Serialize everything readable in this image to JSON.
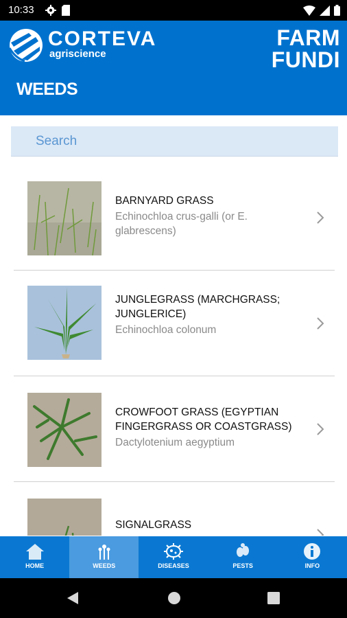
{
  "status": {
    "time": "10:33"
  },
  "header": {
    "brand_name": "CORTEVA",
    "brand_sub": "agriscience",
    "app_name_line1": "FARM",
    "app_name_line2": "FUNDI",
    "page_title": "WEEDS"
  },
  "search": {
    "placeholder": "Search"
  },
  "items": [
    {
      "title": "BARNYARD GRASS",
      "scientific": "Echinochloa crus-galli (or E. glabrescens)"
    },
    {
      "title": "JUNGLEGRASS (MARCHGRASS; JUNGLERICE)",
      "scientific": "Echinochloa colonum"
    },
    {
      "title": "CROWFOOT GRASS (EGYPTIAN FINGERGRASS OR COASTGRASS)",
      "scientific": "Dactylotenium aegyptium"
    },
    {
      "title": "SIGNALGRASS",
      "scientific": ""
    }
  ],
  "nav": [
    {
      "label": "HOME",
      "icon": "home-icon",
      "active": false
    },
    {
      "label": "WEEDS",
      "icon": "weeds-icon",
      "active": true
    },
    {
      "label": "DISEASES",
      "icon": "diseases-icon",
      "active": false
    },
    {
      "label": "PESTS",
      "icon": "pests-icon",
      "active": false
    },
    {
      "label": "INFO",
      "icon": "info-icon",
      "active": false
    }
  ],
  "colors": {
    "header_blue": "#0072ce",
    "nav_blue": "#0a78d2",
    "search_bg": "#dbe8f6"
  }
}
